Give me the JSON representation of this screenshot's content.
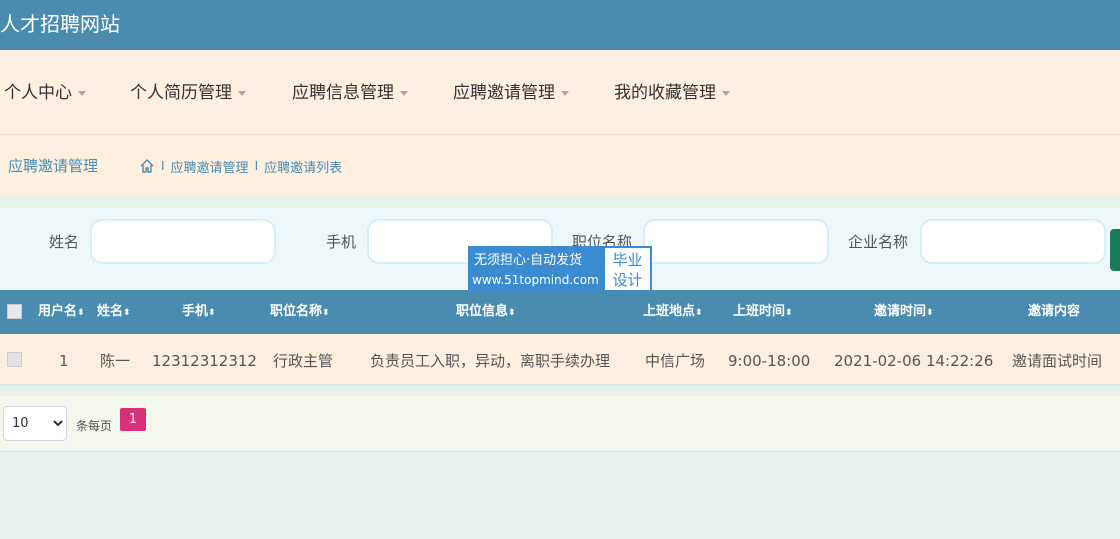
{
  "header": {
    "title": "人才招聘网站"
  },
  "nav": {
    "items": [
      {
        "label": "个人中心"
      },
      {
        "label": "个人简历管理"
      },
      {
        "label": "应聘信息管理"
      },
      {
        "label": "应聘邀请管理"
      },
      {
        "label": "我的收藏管理"
      }
    ]
  },
  "breadcrumb": {
    "title": "应聘邀请管理",
    "crumb1": "应聘邀请管理",
    "crumb2": "应聘邀请列表",
    "separator": "I"
  },
  "search": {
    "name_label": "姓名",
    "phone_label": "手机",
    "position_label": "职位名称",
    "company_label": "企业名称",
    "name_value": "",
    "phone_value": "",
    "position_value": "",
    "company_value": ""
  },
  "watermark": {
    "line1": "无须担心·自动发货",
    "line2": "www.51topmind.com",
    "right1": "毕业",
    "right2": "设计"
  },
  "table": {
    "columns": [
      "用户名",
      "姓名",
      "手机",
      "职位名称",
      "职位信息",
      "上班地点",
      "上班时间",
      "邀请时间",
      "邀请内容"
    ],
    "sort_glyph": "⬍",
    "rows": [
      {
        "username": "1",
        "name": "陈一",
        "phone": "12312312312",
        "position": "行政主管",
        "position_info": "负责员工入职，异动，离职手续办理",
        "location": "中信广场",
        "work_time": "9:00-18:00",
        "invite_time": "2021-02-06 14:22:26",
        "invite_content": "邀请面试时间"
      }
    ]
  },
  "pager": {
    "page_size": "10",
    "page_size_options": [
      "10"
    ],
    "per_page_label": "条每页",
    "current_page": "1"
  },
  "colors": {
    "header_bg": "#4a8bb0",
    "nav_bg": "#fdf0e0",
    "accent": "#4a8bb0",
    "page_active": "#d8317a"
  }
}
